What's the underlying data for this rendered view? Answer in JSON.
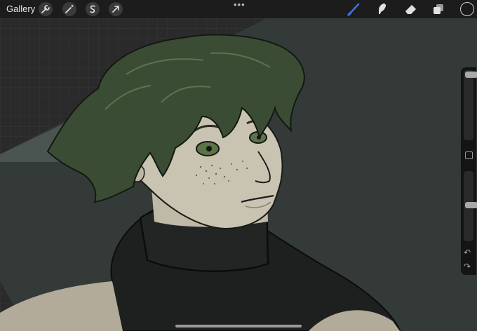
{
  "toolbar": {
    "gallery_label": "Gallery",
    "left_tools": [
      "wrench-icon",
      "magic-wand-icon",
      "selection-icon",
      "transform-icon"
    ],
    "more_icon": "•••",
    "right_tools": [
      "brush-icon",
      "smudge-icon",
      "eraser-icon",
      "layers-icon"
    ],
    "active_tool": "brush-icon",
    "current_color": "#1a1a1a"
  },
  "sidebar": {
    "brush_size_level": 0.05,
    "opacity_level": 0.55,
    "undo_icon": "↶",
    "redo_icon": "↷"
  },
  "colors": {
    "background": "#333a38",
    "hair": "#3a4d34",
    "skin": "#c9c3b1",
    "turtleneck": "#1e2020",
    "accent": "#3c6ee0"
  }
}
